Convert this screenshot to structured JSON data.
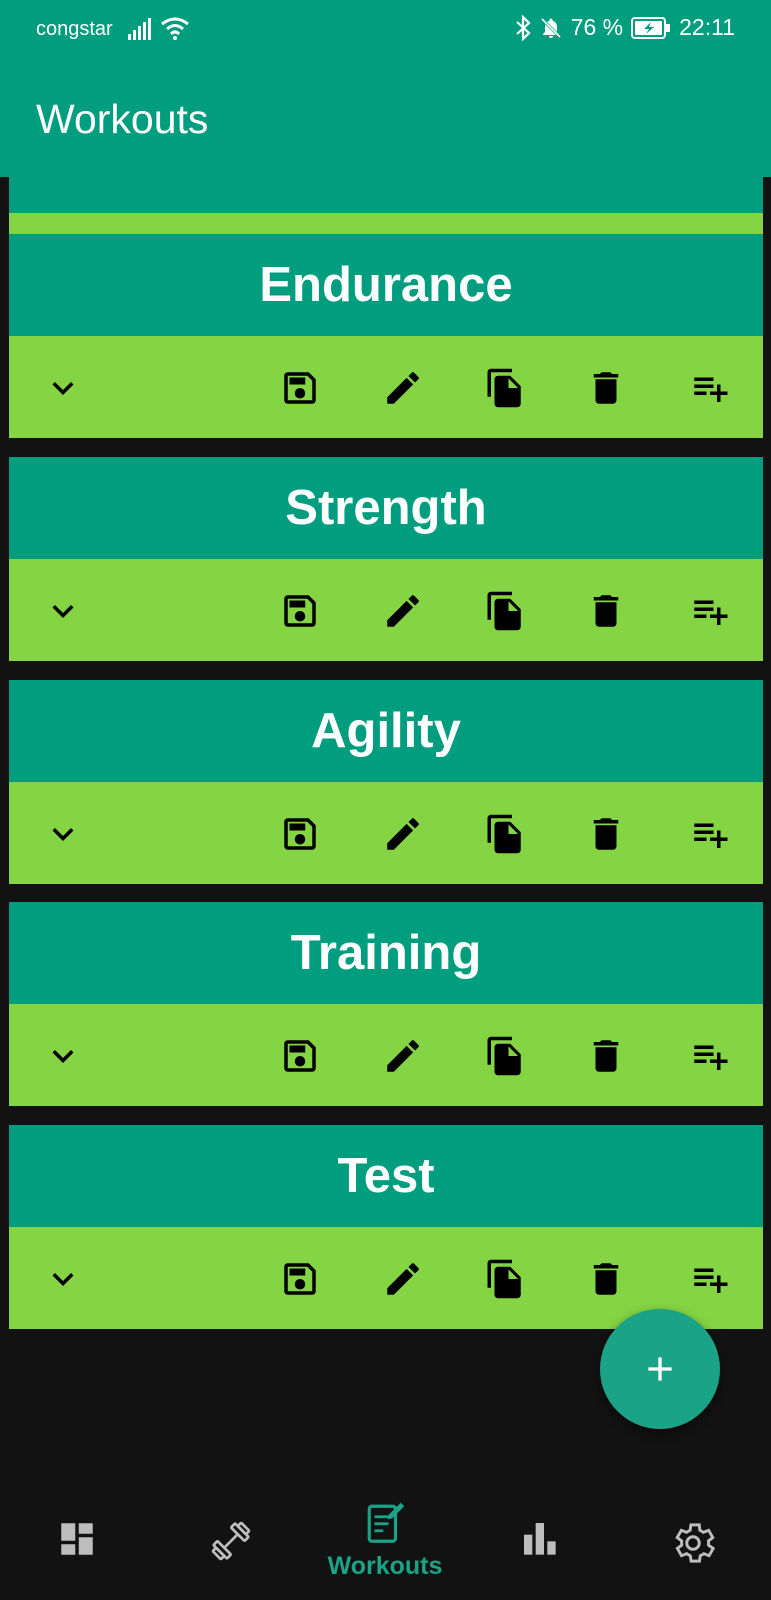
{
  "status_bar": {
    "carrier": "congstar",
    "battery_percent": "76 %",
    "time": "22:11",
    "icons": [
      "signal-icon",
      "wifi-icon",
      "bluetooth-icon",
      "notifications-off-icon",
      "battery-charging-icon"
    ]
  },
  "app_bar": {
    "title": "Workouts"
  },
  "workouts": [
    {
      "name": ""
    },
    {
      "name": "Endurance"
    },
    {
      "name": "Strength"
    },
    {
      "name": "Agility"
    },
    {
      "name": "Training"
    },
    {
      "name": "Test"
    }
  ],
  "card_actions": [
    "expand-icon",
    "save-icon",
    "edit-icon",
    "copy-icon",
    "delete-icon",
    "add-to-list-icon"
  ],
  "fab": {
    "icon": "add-icon"
  },
  "bottom_nav": {
    "items": [
      {
        "icon": "dashboard-icon",
        "label": ""
      },
      {
        "icon": "dumbbell-icon",
        "label": ""
      },
      {
        "icon": "workouts-icon",
        "label": "Workouts",
        "active": true
      },
      {
        "icon": "stats-icon",
        "label": ""
      },
      {
        "icon": "settings-icon",
        "label": ""
      }
    ]
  },
  "colors": {
    "primary": "#009e7e",
    "accent_green": "#85d443",
    "background": "#121212",
    "fab": "#1aa386"
  }
}
